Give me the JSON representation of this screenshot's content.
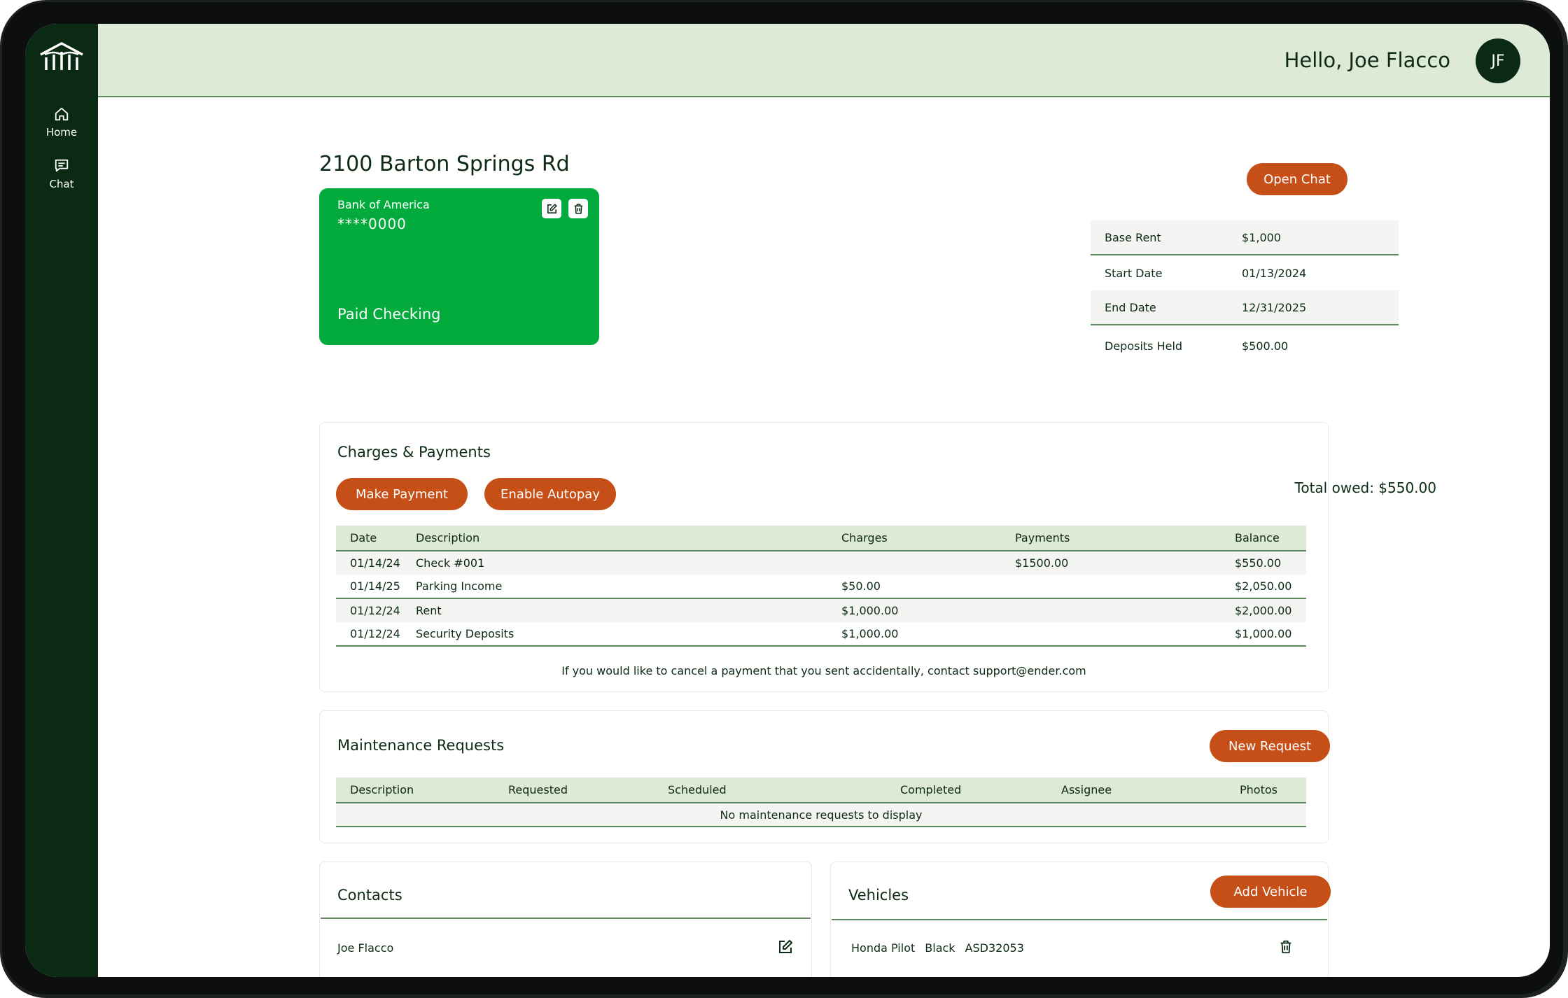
{
  "sidebar": {
    "logo_icon": "building-columns-logo",
    "items": [
      {
        "label": "Home",
        "icon": "home-icon"
      },
      {
        "label": "Chat",
        "icon": "chat-icon"
      }
    ]
  },
  "header": {
    "greeting": "Hello, Joe Flacco",
    "avatar_initials": "JF"
  },
  "property": {
    "title": "2100 Barton Springs Rd",
    "open_chat_label": "Open Chat"
  },
  "bank_account": {
    "bank_name": "Bank of America",
    "account_number": "****0000",
    "status": "Paid Checking",
    "card_color": "#02ab3b"
  },
  "lease": {
    "rows": [
      {
        "label": "Base Rent",
        "value": "$1,000"
      },
      {
        "label": "Start Date",
        "value": "01/13/2024"
      },
      {
        "label": "End Date",
        "value": "12/31/2025"
      },
      {
        "label": "Deposits Held",
        "value": "$500.00"
      }
    ]
  },
  "charges": {
    "title": "Charges & Payments",
    "make_payment_label": "Make Payment",
    "enable_autopay_label": "Enable Autopay",
    "total_owed": "Total owed: $550.00",
    "columns": [
      "Date",
      "Description",
      "Charges",
      "Payments",
      "Balance"
    ],
    "rows": [
      {
        "date": "01/14/24",
        "description": "Check #001",
        "charges": "",
        "payments": "$1500.00",
        "balance": "$550.00"
      },
      {
        "date": "01/14/25",
        "description": "Parking Income",
        "charges": "$50.00",
        "payments": "",
        "balance": "$2,050.00"
      },
      {
        "date": "01/12/24",
        "description": "Rent",
        "charges": "$1,000.00",
        "payments": "",
        "balance": "$2,000.00"
      },
      {
        "date": "01/12/24",
        "description": "Security Deposits",
        "charges": "$1,000.00",
        "payments": "",
        "balance": "$1,000.00"
      }
    ],
    "note": "If you would like to cancel a payment that you sent accidentally, contact support@ender.com"
  },
  "maintenance": {
    "title": "Maintenance Requests",
    "new_request_label": "New Request",
    "columns": [
      "Description",
      "Requested",
      "Scheduled",
      "Completed",
      "Assignee",
      "Photos"
    ],
    "empty_message": "No maintenance requests to display"
  },
  "contacts": {
    "title": "Contacts",
    "items": [
      {
        "name": "Joe Flacco"
      }
    ]
  },
  "vehicles": {
    "title": "Vehicles",
    "add_label": "Add Vehicle",
    "items": [
      {
        "make_model": "Honda Pilot",
        "color": "Black",
        "plate": "ASD32053"
      }
    ]
  },
  "colors": {
    "accent": "#c64f18",
    "sidebar": "#0b2a14",
    "header": "#deead8",
    "bank_card": "#02ab3b"
  }
}
